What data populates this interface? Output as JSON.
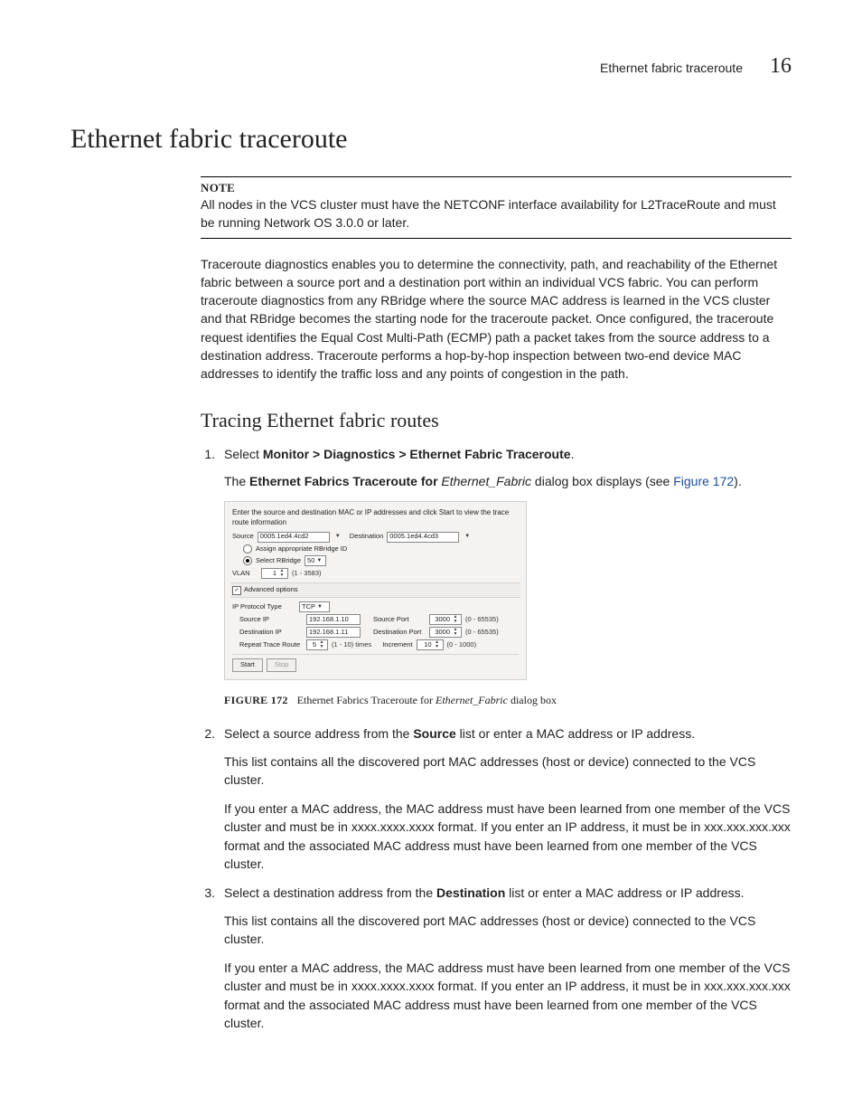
{
  "header": {
    "running_title": "Ethernet fabric traceroute",
    "chapter_number": "16"
  },
  "h1": "Ethernet fabric traceroute",
  "note": {
    "head": "NOTE",
    "body": "All nodes in the VCS cluster must have the NETCONF interface availability for L2TraceRoute and must be running Network OS 3.0.0 or later."
  },
  "intro": "Traceroute diagnostics enables you to determine the connectivity, path, and reachability of the Ethernet fabric between a source port and a destination port within an individual VCS fabric. You can perform traceroute diagnostics from any RBridge where the source MAC address is learned in the VCS cluster and that RBridge becomes the starting node for the traceroute packet. Once configured, the traceroute request identifies the Equal Cost Multi-Path (ECMP) path a packet takes from the source address to a destination address. Traceroute performs a hop-by-hop inspection between two-end device MAC addresses to identify the traffic loss and any points of congestion in the path.",
  "h2": "Tracing Ethernet fabric routes",
  "step1": {
    "pre": "Select ",
    "menu": "Monitor > Diagnostics > Ethernet Fabric Traceroute",
    "post": ".",
    "result_pre": "The ",
    "result_bold": "Ethernet Fabrics Traceroute for ",
    "result_italic": "Ethernet_Fabric",
    "result_mid": " dialog box displays (see ",
    "xref": "Figure 172",
    "result_end": ")."
  },
  "figure": {
    "num": "FIGURE 172",
    "title_a": "Ethernet Fabrics Traceroute for ",
    "title_it": "Ethernet_Fabric",
    "title_b": " dialog box"
  },
  "dlg": {
    "instr": "Enter the source and destination MAC or IP addresses and click Start to view the trace route information",
    "source_label": "Source",
    "source_value": "0005.1ed4.4cd2",
    "dest_label": "Destination",
    "dest_value": "0005.1ed4.4cd3",
    "assign_label": "Assign appropriate RBridge ID",
    "select_rbridge_label": "Select RBridge",
    "select_rbridge_value": "50",
    "vlan_label": "VLAN",
    "vlan_value": "1",
    "vlan_range": "(1 - 3583)",
    "adv_label": "Advanced options",
    "proto_label": "IP Protocol Type",
    "proto_value": "TCP",
    "src_ip_label": "Source IP",
    "src_ip_value": "192.168.1.10",
    "src_port_label": "Source Port",
    "src_port_value": "3000",
    "port_range": "(0 - 65535)",
    "dst_ip_label": "Destination IP",
    "dst_ip_value": "192.168.1.11",
    "dst_port_label": "Destination Port",
    "dst_port_value": "3000",
    "repeat_label": "Repeat Trace Route",
    "repeat_value": "5",
    "repeat_range": "(1 - 10)  times",
    "incr_label": "Increment",
    "incr_value": "10",
    "incr_range": "(0 - 1000)",
    "start_btn": "Start",
    "stop_btn": "Stop"
  },
  "step2": {
    "pre": "Select a source address from the ",
    "bold": "Source",
    "post": " list or enter a MAC address or IP address.",
    "p1": "This list contains all the discovered port MAC addresses (host or device) connected to the VCS cluster.",
    "p2": "If you enter a MAC address, the MAC address must have been learned from one member of the VCS cluster and must be in xxxx.xxxx.xxxx format. If you enter an IP address, it must be in xxx.xxx.xxx.xxx format and the associated MAC address must have been learned from one member of the VCS cluster."
  },
  "step3": {
    "pre": "Select a destination address from the ",
    "bold": "Destination",
    "post": " list or enter a MAC address or IP address.",
    "p1": "This list contains all the discovered port MAC addresses (host or device) connected to the VCS cluster.",
    "p2": "If you enter a MAC address, the MAC address must have been learned from one member of the VCS cluster and must be in xxxx.xxxx.xxxx format. If you enter an IP address, it must be in xxx.xxx.xxx.xxx format and the associated MAC address must have been learned from one member of the VCS cluster."
  }
}
